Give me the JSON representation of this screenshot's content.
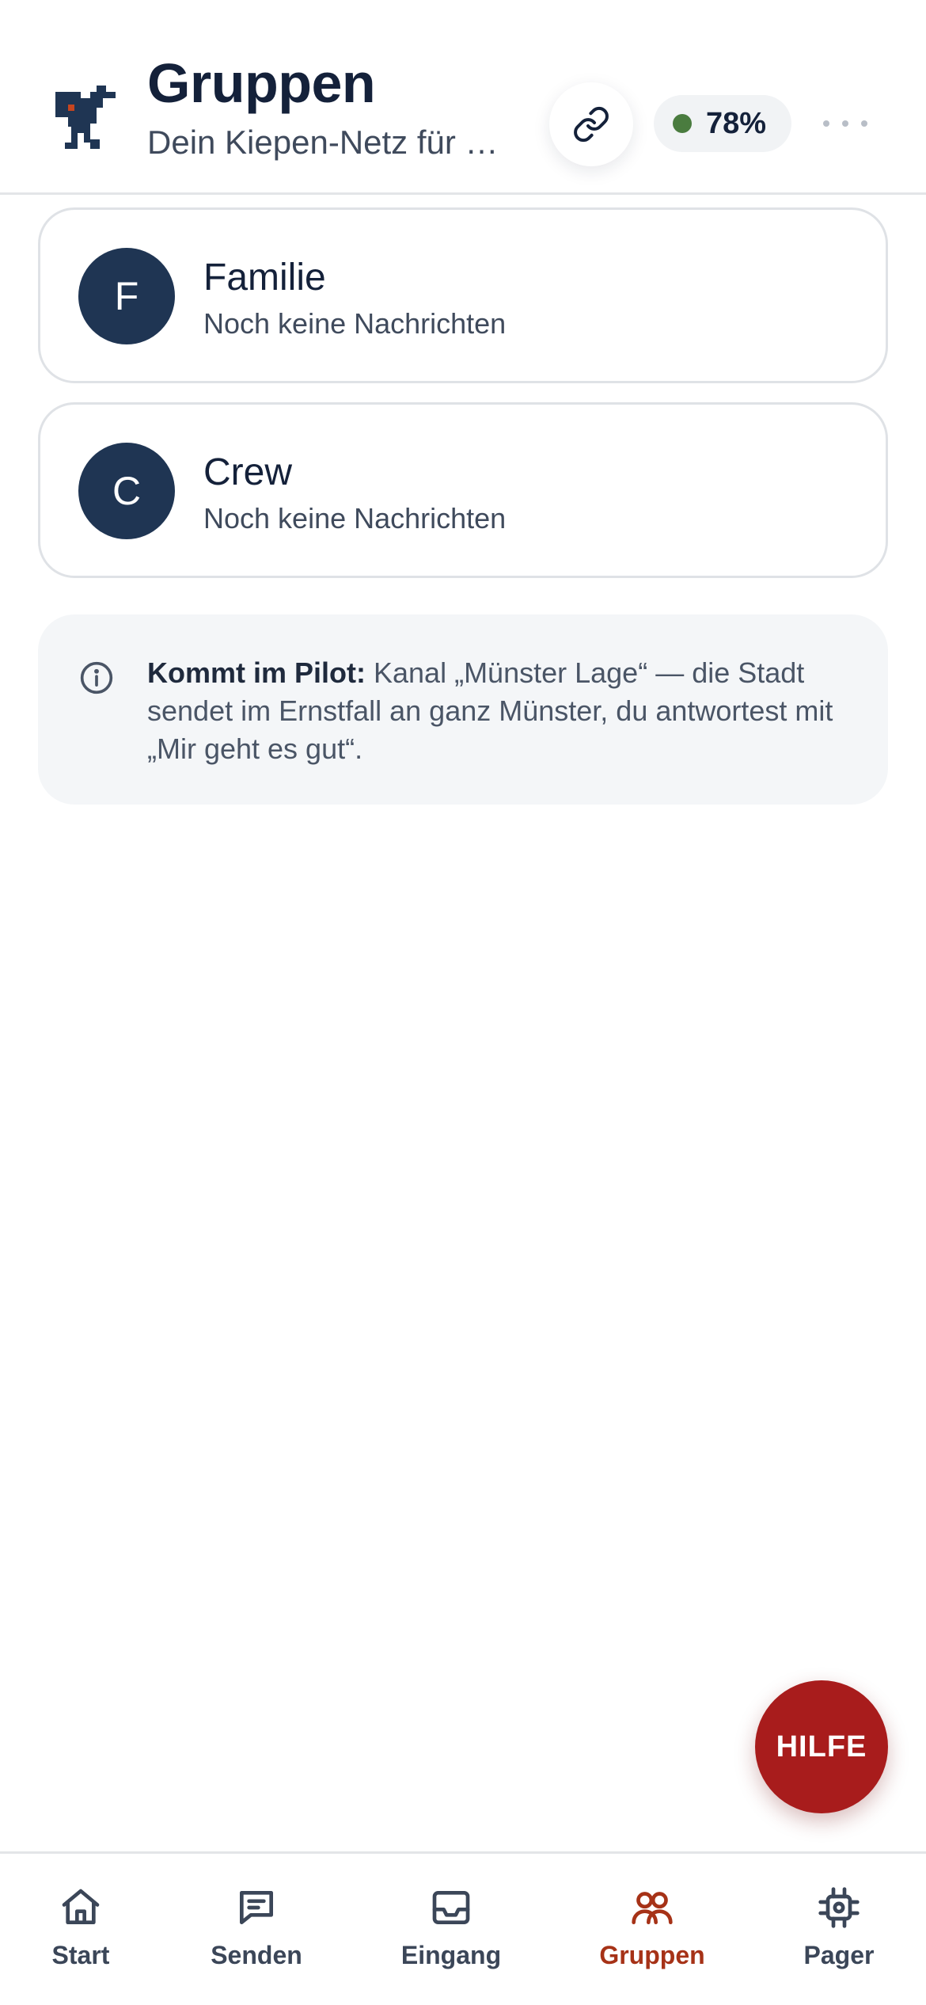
{
  "header": {
    "title": "Gruppen",
    "subtitle": "Dein Kiepen-Netz für …",
    "battery_percent": "78%",
    "battery_status_color": "#4a7c3f",
    "icons": {
      "logo": "kiepenkerl-pixel-logo",
      "link": "link-icon",
      "more": "more-dots-icon"
    }
  },
  "groups": [
    {
      "initial": "F",
      "name": "Familie",
      "last_message": "Noch keine Nachrichten"
    },
    {
      "initial": "C",
      "name": "Crew",
      "last_message": "Noch keine Nachrichten"
    }
  ],
  "info": {
    "label": "Kommt im Pilot:",
    "text": " Kanal „Münster Lage“ — die Stadt sendet im Ernstfall an ganz Münster, du antwortest mit „Mir geht es gut“."
  },
  "fab": {
    "label": "HILFE",
    "color": "#a81c1c"
  },
  "nav": {
    "active": "Gruppen",
    "active_color": "#a63217",
    "items": [
      {
        "label": "Start",
        "icon": "home-icon"
      },
      {
        "label": "Senden",
        "icon": "chat-icon"
      },
      {
        "label": "Eingang",
        "icon": "inbox-icon"
      },
      {
        "label": "Gruppen",
        "icon": "users-icon"
      },
      {
        "label": "Pager",
        "icon": "chip-icon"
      }
    ]
  },
  "colors": {
    "primary": "#1f3553",
    "text": "#14213a",
    "muted": "#3f4a5c"
  }
}
